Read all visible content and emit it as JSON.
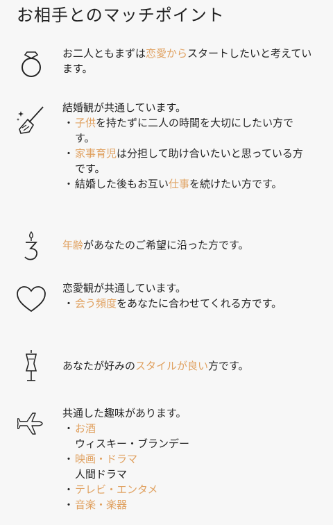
{
  "title": "お相手とのマッチポイント",
  "points": [
    {
      "icon": "ring-icon",
      "line1_pre": "お二人ともまずは",
      "line1_hl": "恋愛から",
      "line1_post": "スタートしたいと考えています。"
    },
    {
      "icon": "broom-icon",
      "heading": "結婚観が共通しています。",
      "bullets": [
        {
          "hl": "子供",
          "rest": "を持たずに二人の時間を大切にしたい方です。"
        },
        {
          "hl": "家事育児",
          "rest": "は分担して助け合いたいと思っている方です。"
        },
        {
          "pre": "結婚した後もお互い",
          "hl": "仕事",
          "rest": "を続けたい方です。"
        }
      ]
    },
    {
      "icon": "age-candle-icon",
      "hl": "年齢",
      "rest": "があなたのご希望に沿った方です。"
    },
    {
      "icon": "heart-icon",
      "heading": "恋愛観が共通しています。",
      "bullets": [
        {
          "hl": "会う頻度",
          "rest": "をあなたに合わせてくれる方です。"
        }
      ]
    },
    {
      "icon": "dress-form-icon",
      "pre": "あなたが好みの",
      "hl": "スタイルが良い",
      "rest": "方です。"
    },
    {
      "icon": "airplane-icon",
      "heading": "共通した趣味があります。",
      "hobbies": [
        {
          "cat": "お酒",
          "detail": "ウィスキー・ブランデー"
        },
        {
          "cat": "映画・ドラマ",
          "detail": "人間ドラマ"
        },
        {
          "cat": "テレビ・エンタメ",
          "detail": ""
        },
        {
          "cat": "音楽・楽器",
          "detail": ""
        }
      ]
    }
  ],
  "bullet_char": "・",
  "colors": {
    "highlight": "#e0a160",
    "text": "#222222",
    "background": "#f7f7f7"
  }
}
